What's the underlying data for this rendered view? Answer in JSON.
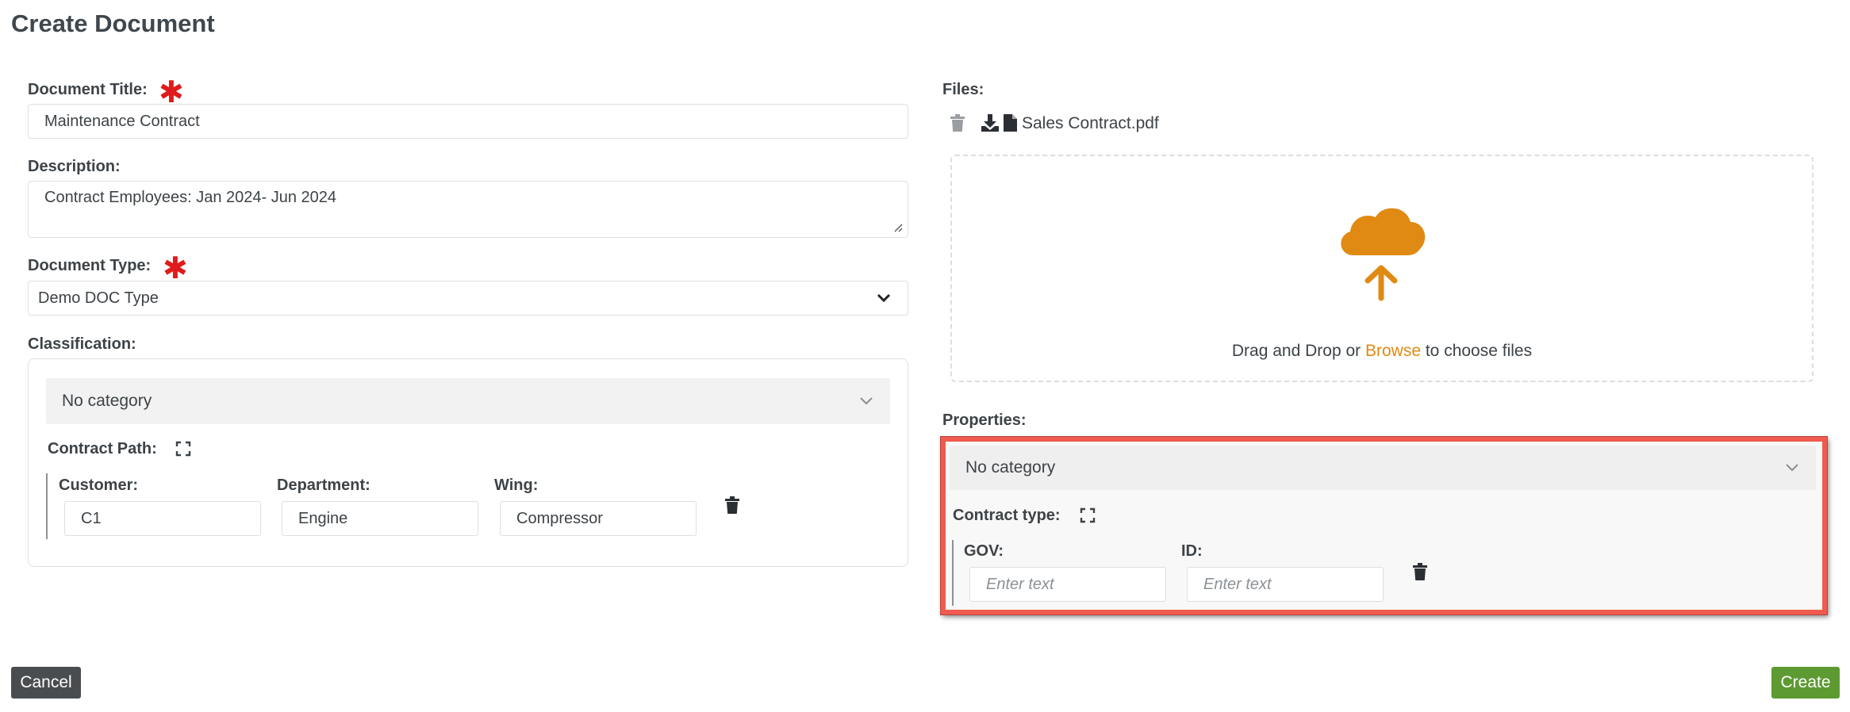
{
  "page": {
    "title": "Create Document"
  },
  "form": {
    "document_title": {
      "label": "Document Title:",
      "value": "Maintenance Contract"
    },
    "description": {
      "label": "Description:",
      "value": "Contract Employees: Jan 2024- Jun 2024"
    },
    "document_type": {
      "label": "Document Type:",
      "value": "Demo DOC Type"
    },
    "classification": {
      "label": "Classification:",
      "category": "No category",
      "path_label": "Contract Path:",
      "fields": [
        {
          "label": "Customer:",
          "value": "C1"
        },
        {
          "label": "Department:",
          "value": "Engine"
        },
        {
          "label": "Wing:",
          "value": "Compressor"
        }
      ]
    }
  },
  "files": {
    "label": "Files:",
    "items": [
      {
        "name": "Sales Contract.pdf"
      }
    ],
    "dropzone": {
      "text_before": "Drag and Drop or ",
      "link": "Browse",
      "text_after": " to choose files"
    }
  },
  "properties": {
    "label": "Properties:",
    "category": "No category",
    "type_label": "Contract type:",
    "fields": [
      {
        "label": "GOV:",
        "placeholder": "Enter text"
      },
      {
        "label": "ID:",
        "placeholder": "Enter text"
      }
    ]
  },
  "actions": {
    "cancel": "Cancel",
    "create": "Create"
  },
  "colors": {
    "accent_orange": "#e08a14",
    "required_red": "#e01b1b",
    "highlight_border": "#ef5b4f",
    "create_green": "#5d9a32",
    "cancel_dark": "#4a4d50"
  },
  "icons": [
    "asterisk-icon",
    "chevron-down-icon",
    "expand-icon",
    "trash-icon",
    "download-icon",
    "file-icon",
    "cloud-upload-icon",
    "resize-handle-icon"
  ]
}
